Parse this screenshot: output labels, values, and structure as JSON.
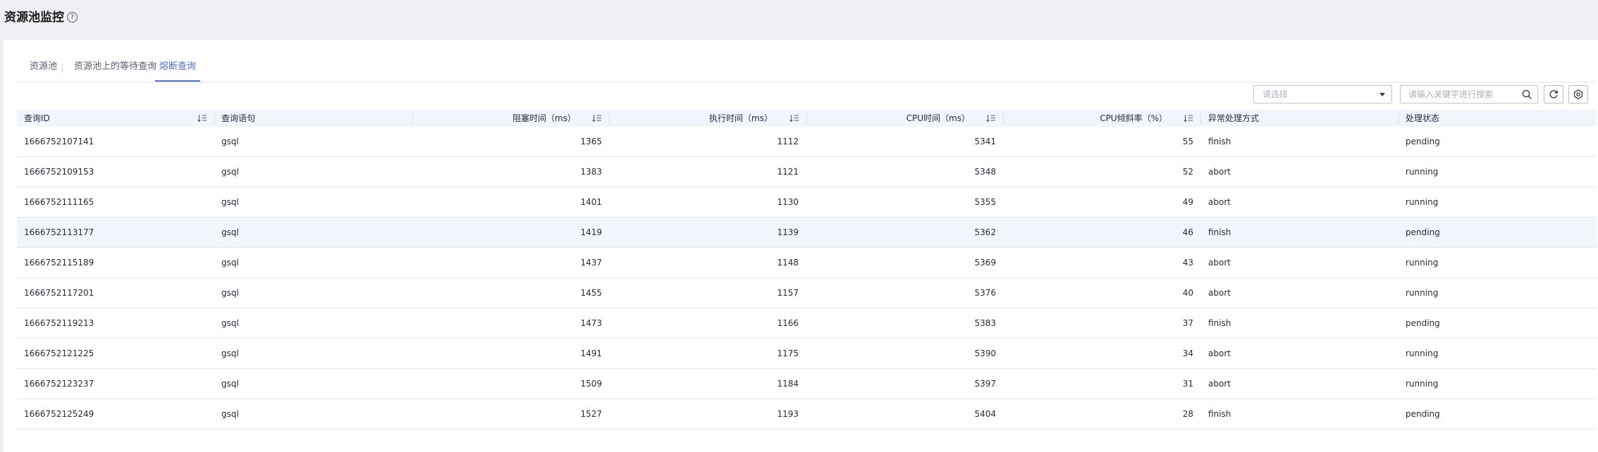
{
  "page": {
    "title": "资源池监控",
    "help_glyph": "?"
  },
  "tabs": [
    {
      "label": "资源池",
      "active": false
    },
    {
      "label": "资源池上的等待查询",
      "active": false
    },
    {
      "label": "熔断查询",
      "active": true
    }
  ],
  "toolbar": {
    "select_placeholder": "请选择",
    "search_placeholder": "请输入关键字进行搜索",
    "icons": [
      "chevron-down-icon",
      "search-icon",
      "refresh-icon",
      "settings-icon"
    ]
  },
  "table": {
    "columns": [
      {
        "label": "查询ID",
        "sortable": true
      },
      {
        "label": "查询语句",
        "sortable": false
      },
      {
        "label": "阻塞时间（ms）",
        "sortable": true
      },
      {
        "label": "执行时间（ms）",
        "sortable": true
      },
      {
        "label": "CPU时间（ms）",
        "sortable": true
      },
      {
        "label": "CPU倾斜率（%）",
        "sortable": true
      },
      {
        "label": "异常处理方式",
        "sortable": false
      },
      {
        "label": "处理状态",
        "sortable": false
      }
    ],
    "highlighted_row": 3,
    "rows": [
      [
        "1666752107141",
        "gsql",
        "1365",
        "1112",
        "5341",
        "55",
        "finish",
        "pending"
      ],
      [
        "1666752109153",
        "gsql",
        "1383",
        "1121",
        "5348",
        "52",
        "abort",
        "running"
      ],
      [
        "1666752111165",
        "gsql",
        "1401",
        "1130",
        "5355",
        "49",
        "abort",
        "running"
      ],
      [
        "1666752113177",
        "gsql",
        "1419",
        "1139",
        "5362",
        "46",
        "finish",
        "pending"
      ],
      [
        "1666752115189",
        "gsql",
        "1437",
        "1148",
        "5369",
        "43",
        "abort",
        "running"
      ],
      [
        "1666752117201",
        "gsql",
        "1455",
        "1157",
        "5376",
        "40",
        "abort",
        "running"
      ],
      [
        "1666752119213",
        "gsql",
        "1473",
        "1166",
        "5383",
        "37",
        "finish",
        "pending"
      ],
      [
        "1666752121225",
        "gsql",
        "1491",
        "1175",
        "5390",
        "34",
        "abort",
        "running"
      ],
      [
        "1666752123237",
        "gsql",
        "1509",
        "1184",
        "5397",
        "31",
        "abort",
        "running"
      ],
      [
        "1666752125249",
        "gsql",
        "1527",
        "1193",
        "5404",
        "28",
        "finish",
        "pending"
      ]
    ]
  },
  "colors": {
    "accent": "#526ecc",
    "header_bg": "#f2f5fc",
    "page_bg": "#eff0f4"
  }
}
